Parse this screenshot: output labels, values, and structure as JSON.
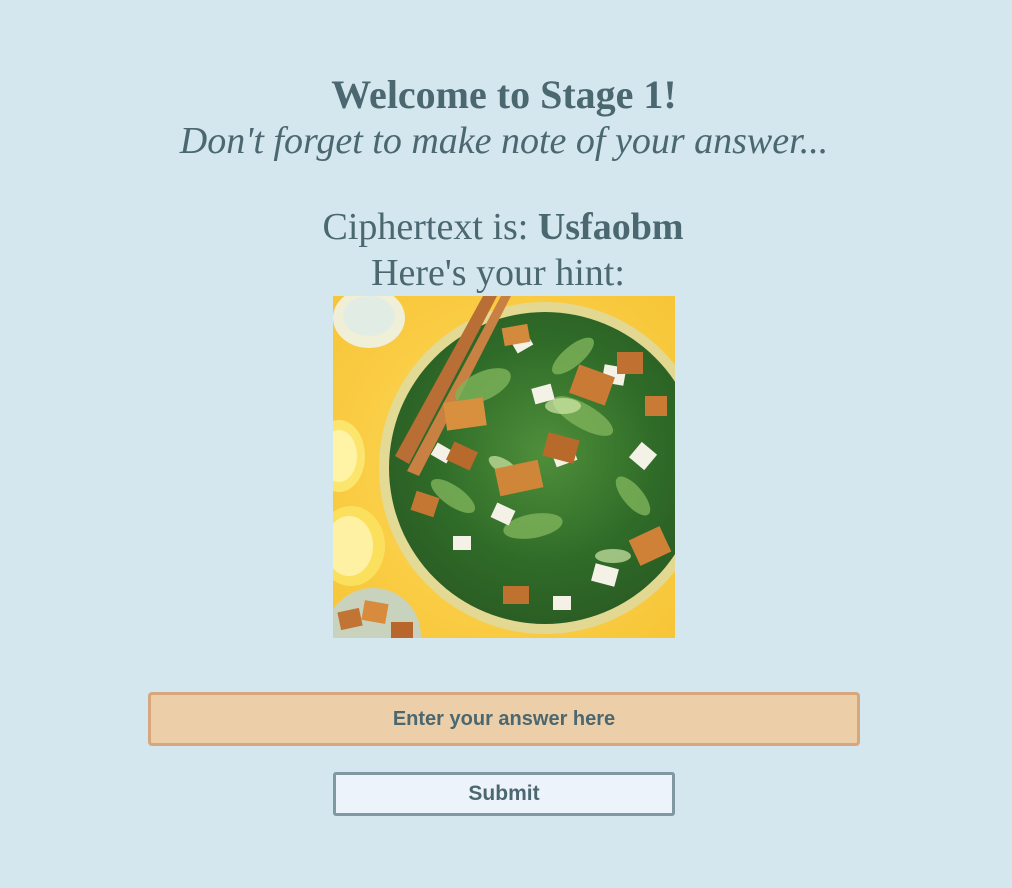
{
  "header": {
    "title": "Welcome to Stage 1!",
    "subtitle": "Don't forget to make note of your answer..."
  },
  "cipher": {
    "label": "Ciphertext is: ",
    "value": "Usfaobm"
  },
  "hint": {
    "label": "Here's your hint:",
    "image_icon": "caesar-salad-photo"
  },
  "form": {
    "answer_placeholder": "Enter your answer here",
    "answer_value": "",
    "submit_label": "Submit"
  },
  "colors": {
    "background": "#d4e7ef",
    "text": "#4b6770",
    "input_fill": "#eccfa9",
    "input_border": "#d6a67d",
    "button_fill": "#edf3fb",
    "button_border": "#7f98a2"
  }
}
